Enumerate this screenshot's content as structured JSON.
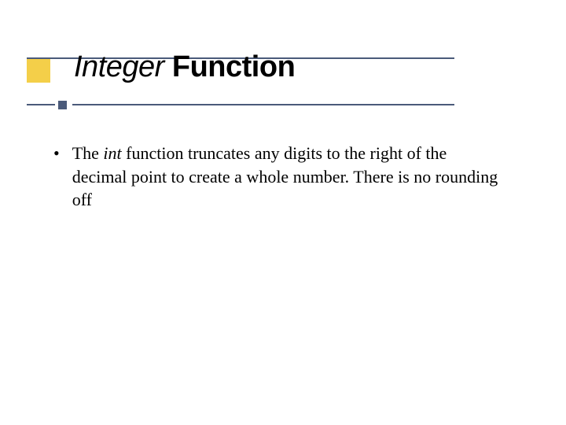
{
  "title": {
    "italic": "Integer",
    "bold": " Function"
  },
  "body": {
    "bullet": {
      "prefix": "The ",
      "italic": "int",
      "rest": " function truncates any digits to the right of the decimal point to create a whole number. There is no rounding off"
    }
  }
}
